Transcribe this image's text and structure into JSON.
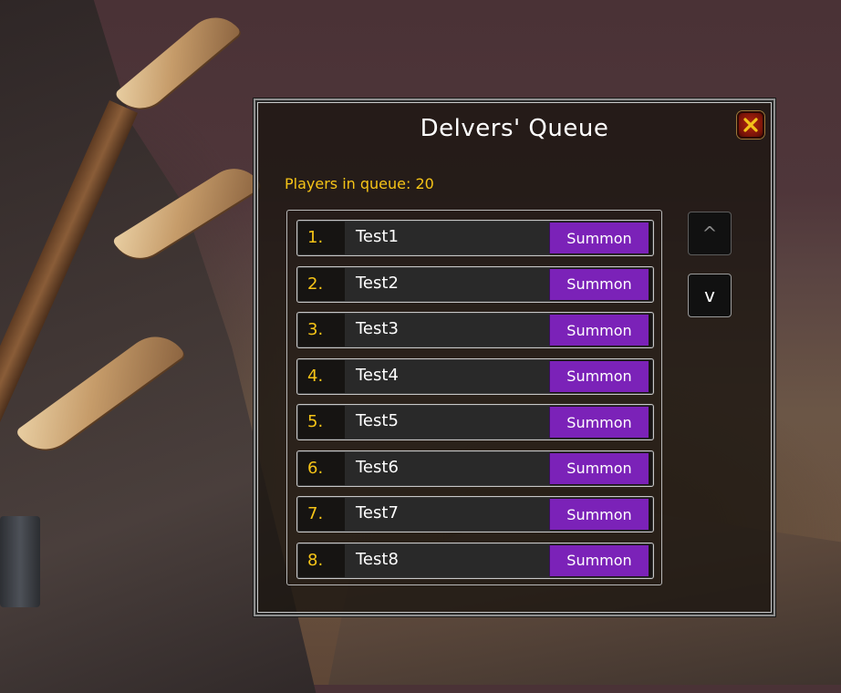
{
  "window": {
    "title": "Delvers' Queue",
    "queue_count_text": "Players in queue: 20"
  },
  "queue": [
    {
      "index": "1.",
      "name": "Test1",
      "action": "Summon"
    },
    {
      "index": "2.",
      "name": "Test2",
      "action": "Summon"
    },
    {
      "index": "3.",
      "name": "Test3",
      "action": "Summon"
    },
    {
      "index": "4.",
      "name": "Test4",
      "action": "Summon"
    },
    {
      "index": "5.",
      "name": "Test5",
      "action": "Summon"
    },
    {
      "index": "6.",
      "name": "Test6",
      "action": "Summon"
    },
    {
      "index": "7.",
      "name": "Test7",
      "action": "Summon"
    },
    {
      "index": "8.",
      "name": "Test8",
      "action": "Summon"
    }
  ],
  "scroll": {
    "up_label": "^",
    "down_label": "v"
  },
  "icons": {
    "close": "close-icon"
  },
  "colors": {
    "accent_gold": "#f6c417",
    "summon_purple": "#7b22b8",
    "close_red": "#b3250f"
  }
}
